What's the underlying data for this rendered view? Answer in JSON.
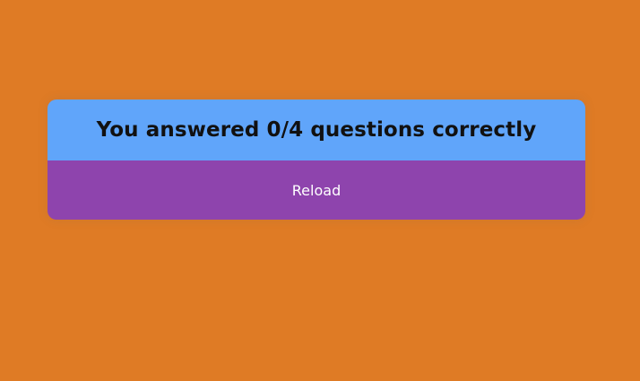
{
  "colors": {
    "page_background": "#df7b25",
    "header_background": "#60a5fa",
    "button_background": "#8e44ad",
    "header_text": "#111111",
    "button_text": "#ffffff"
  },
  "quiz": {
    "result_text": "You answered 0/4 questions correctly",
    "score_correct": 0,
    "score_total": 4,
    "reload_label": "Reload"
  }
}
